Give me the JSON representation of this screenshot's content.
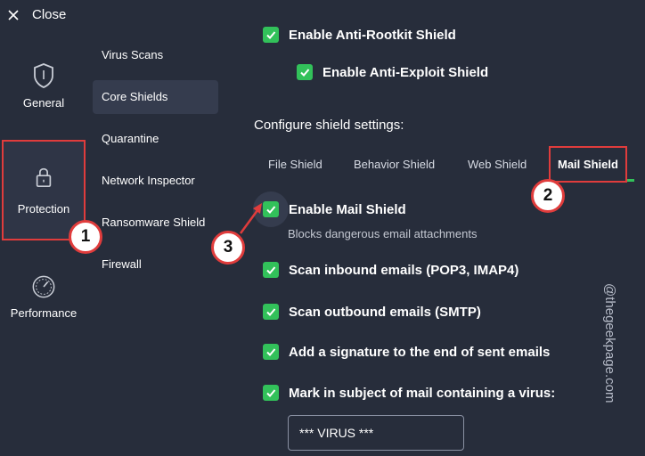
{
  "close_label": "Close",
  "rail": [
    {
      "label": "General",
      "icon": "shield-icon"
    },
    {
      "label": "Protection",
      "icon": "lock-icon"
    },
    {
      "label": "Performance",
      "icon": "gauge-icon"
    }
  ],
  "submenu": [
    "Virus Scans",
    "Core Shields",
    "Quarantine",
    "Network Inspector",
    "Ransomware Shield",
    "Firewall"
  ],
  "top_options": {
    "anti_rootkit": "Enable Anti-Rootkit Shield",
    "anti_exploit": "Enable Anti-Exploit Shield"
  },
  "section_heading": "Configure shield settings:",
  "tabs": [
    "File Shield",
    "Behavior Shield",
    "Web Shield",
    "Mail Shield"
  ],
  "mail": {
    "enable": "Enable Mail Shield",
    "enable_desc": "Blocks dangerous email attachments",
    "inbound": "Scan inbound emails (POP3, IMAP4)",
    "outbound": "Scan outbound emails (SMTP)",
    "signature": "Add a signature to the end of sent emails",
    "mark_subject": "Mark in subject of mail containing a virus:",
    "virus_tag": "*** VIRUS ***"
  },
  "callouts": {
    "one": "1",
    "two": "2",
    "three": "3"
  },
  "watermark": "@thegeekpage.com",
  "colors": {
    "background": "#272d3b",
    "accent_green": "#32c15a",
    "highlight_red": "#e03c3c"
  }
}
